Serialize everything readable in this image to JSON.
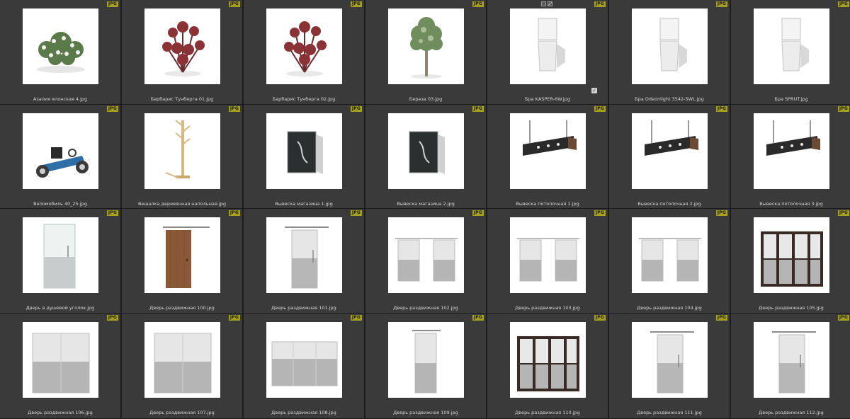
{
  "thumbnails": [
    {
      "file": "Азалия японская 4.jpg",
      "badge": "JPG",
      "icon": "flowering-shrub-icon"
    },
    {
      "file": "Барбарис Тунберга 01.jpg",
      "badge": "JPG",
      "icon": "red-shrub-icon"
    },
    {
      "file": "Барбарис Тунберга 02.jpg",
      "badge": "JPG",
      "icon": "red-shrub-icon"
    },
    {
      "file": "Береза 03.jpg",
      "badge": "JPG",
      "icon": "birch-tree-icon"
    },
    {
      "file": "Бра KASPER-6W.jpg",
      "badge": "JPG",
      "icon": "wall-sconce-icon",
      "selected": true
    },
    {
      "file": "Бра Odeonlight 3542-5WL.jpg",
      "badge": "JPG",
      "icon": "wall-sconce-icon"
    },
    {
      "file": "Бра SPRUT.jpg",
      "badge": "JPG",
      "icon": "wall-sconce-icon"
    },
    {
      "file": "Веломобиль 40_25.jpg",
      "badge": "JPG",
      "icon": "go-kart-icon"
    },
    {
      "file": "Вешалка деревянная напольная.jpg",
      "badge": "JPG",
      "icon": "coat-rack-icon"
    },
    {
      "file": "Вывеска магазина 1.jpg",
      "badge": "JPG",
      "icon": "shop-sign-icon"
    },
    {
      "file": "Вывеска магазина 2.jpg",
      "badge": "JPG",
      "icon": "shop-sign-icon"
    },
    {
      "file": "Вывеска потолочная 1.jpg",
      "badge": "JPG",
      "icon": "ceiling-sign-icon"
    },
    {
      "file": "Вывеска потолочная 2.jpg",
      "badge": "JPG",
      "icon": "ceiling-sign-icon"
    },
    {
      "file": "Вывеска потолочная 3.jpg",
      "badge": "JPG",
      "icon": "ceiling-sign-icon"
    },
    {
      "file": "Дверь в душевой уголок.jpg",
      "badge": "JPG",
      "icon": "shower-door-icon"
    },
    {
      "file": "Дверь раздвижная 100.jpg",
      "badge": "JPG",
      "icon": "wood-sliding-door-icon"
    },
    {
      "file": "Дверь раздвижная 101.jpg",
      "badge": "JPG",
      "icon": "sliding-door-icon"
    },
    {
      "file": "Дверь раздвижная 102.jpg",
      "badge": "JPG",
      "icon": "double-sliding-door-icon"
    },
    {
      "file": "Дверь раздвижная 103.jpg",
      "badge": "JPG",
      "icon": "double-sliding-door-icon"
    },
    {
      "file": "Дверь раздвижная 104.jpg",
      "badge": "JPG",
      "icon": "double-sliding-door-icon"
    },
    {
      "file": "Дверь раздвижная 105.jpg",
      "badge": "JPG",
      "icon": "framed-sliding-door-icon"
    },
    {
      "file": "Дверь раздвижная 106.jpg",
      "badge": "JPG",
      "icon": "glass-double-door-icon"
    },
    {
      "file": "Дверь раздвижная 107.jpg",
      "badge": "JPG",
      "icon": "glass-double-door-icon"
    },
    {
      "file": "Дверь раздвижная 108.jpg",
      "badge": "JPG",
      "icon": "glass-triple-door-icon"
    },
    {
      "file": "Дверь раздвижная 109.jpg",
      "badge": "JPG",
      "icon": "narrow-sliding-door-icon"
    },
    {
      "file": "Дверь раздвижная 110.jpg",
      "badge": "JPG",
      "icon": "framed-sliding-door-icon"
    },
    {
      "file": "Дверь раздвижная 111.jpg",
      "badge": "JPG",
      "icon": "sliding-door-icon"
    },
    {
      "file": "Дверь раздвижная 112.jpg",
      "badge": "JPG",
      "icon": "sliding-door-icon"
    }
  ],
  "colors": {
    "background": "#3a3a3a",
    "badge": "#a6a020",
    "caption": "#d6d6d6"
  }
}
